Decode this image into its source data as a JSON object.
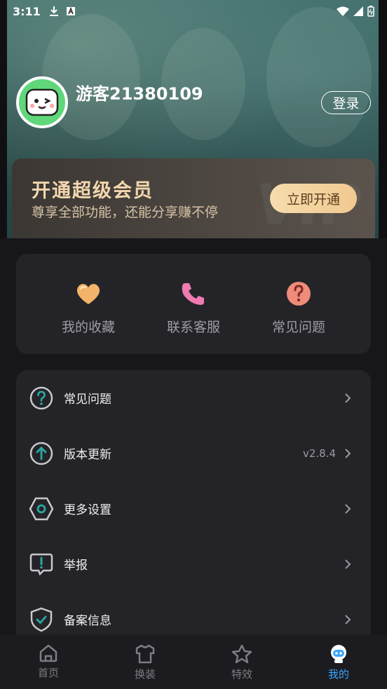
{
  "status_bar": {
    "time": "3:11"
  },
  "profile": {
    "username": "游客21380109",
    "login_label": "登录"
  },
  "vip": {
    "title": "开通超级会员",
    "subtitle": "尊享全部功能，还能分享赚不停",
    "button_label": "立即开通",
    "watermark": "VIP"
  },
  "quick_actions": [
    {
      "label": "我的收藏",
      "icon": "heart-icon"
    },
    {
      "label": "联系客服",
      "icon": "phone-icon"
    },
    {
      "label": "常见问题",
      "icon": "question-icon"
    }
  ],
  "menu": [
    {
      "label": "常见问题",
      "icon": "help-circle-icon",
      "value": ""
    },
    {
      "label": "版本更新",
      "icon": "upload-circle-icon",
      "value": "v2.8.4"
    },
    {
      "label": "更多设置",
      "icon": "settings-hex-icon",
      "value": ""
    },
    {
      "label": "举报",
      "icon": "report-bubble-icon",
      "value": ""
    },
    {
      "label": "备案信息",
      "icon": "shield-check-icon",
      "value": ""
    }
  ],
  "tabs": [
    {
      "label": "首页",
      "icon": "home-icon",
      "active": false
    },
    {
      "label": "换装",
      "icon": "shirt-icon",
      "active": false
    },
    {
      "label": "特效",
      "icon": "star-icon",
      "active": false
    },
    {
      "label": "我的",
      "icon": "robot-icon",
      "active": true
    }
  ],
  "colors": {
    "accent": "#3aa6ff",
    "vip_gold": "#f3d7ae",
    "avatar_green": "#5fd77a"
  }
}
